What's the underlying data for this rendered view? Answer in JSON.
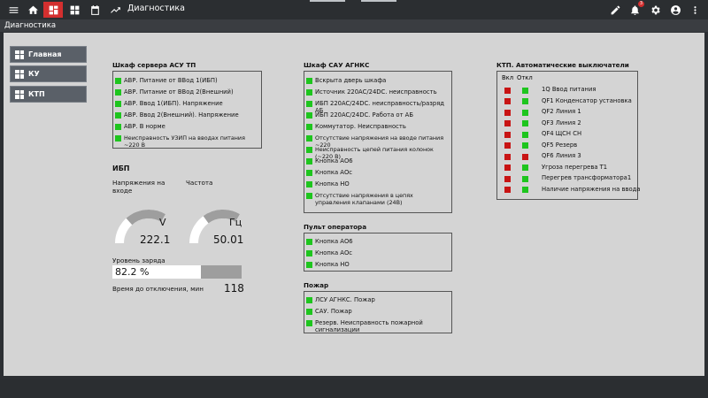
{
  "header": {
    "title": "Диагностика",
    "notification_count": "3"
  },
  "subbar": {
    "title": "Диагностика"
  },
  "nav": [
    {
      "label": "Главная"
    },
    {
      "label": "КУ"
    },
    {
      "label": "КТП"
    }
  ],
  "asu_tp": {
    "title": "Шкаф сервера АСУ ТП",
    "items": [
      "АВР. Питание от ВВод 1(ИБП)",
      "АВР. Питание от ВВод 2(Внешний)",
      "АВР. Ввод 1(ИБП). Напряжение",
      "АВР. Ввод 2(Внешний). Напряжение",
      "АВР. В норме",
      "Неисправность УЗИП на вводах питания ~220 В"
    ]
  },
  "ups": {
    "title": "ИБП",
    "voltage_label": "Напряжения на входе",
    "voltage_unit": "V",
    "voltage_value": "222.1",
    "voltage_level": 0.6,
    "freq_label": "Частота",
    "freq_unit": "Гц",
    "freq_value": "50.01",
    "freq_level": 0.55,
    "charge_label": "Уровень заряда",
    "charge_value": "82.2 %",
    "charge_level": 0.822,
    "time_label": "Время до отключения, мин",
    "time_value": "118"
  },
  "sau": {
    "title": "Шкаф САУ АГНКС",
    "items": [
      "Вскрыта дверь шкафа",
      "Источник 220AC/24DC. неисправность",
      "ИБП 220AC/24DC. неисправность/разряд АБ",
      "ИБП 220AC/24DC. Работа от АБ",
      "Коммутатор. Неисправность",
      "Отсутствие напряжения на вводе питания ~220",
      "Неисправность цепей питания колонок (~220 В)",
      "Кнопка АО6",
      "Кнопка АОс",
      "Кнопка НО",
      "Отсутствие  напряжения в цепях управления клапанами (24В)"
    ]
  },
  "operator": {
    "title": "Пульт оператора",
    "items": [
      "Кнопка АО6",
      "Кнопка АОс",
      "Кнопка НО"
    ]
  },
  "fire": {
    "title": "Пожар",
    "items": [
      "ЛСУ АГНКС. Пожар",
      "САУ. Пожар",
      "Резерв. Неисправность пожарной сигнализации"
    ]
  },
  "ktp": {
    "title": "КТП. Автоматические выключатели",
    "col_on": "Вкл",
    "col_off": "Откл",
    "items": [
      {
        "label": "1Q Ввод питания",
        "on": "red",
        "off": "green"
      },
      {
        "label": "QF1 Конденсатор установка",
        "on": "red",
        "off": "green"
      },
      {
        "label": "QF2 Линия 1",
        "on": "red",
        "off": "green"
      },
      {
        "label": "QF3 Линия 2",
        "on": "red",
        "off": "green"
      },
      {
        "label": "QF4 ЩСН СН",
        "on": "red",
        "off": "green"
      },
      {
        "label": "QF5 Резерв",
        "on": "red",
        "off": "green"
      },
      {
        "label": "QF6 Линия 3",
        "on": "red",
        "off": "red"
      },
      {
        "label": "Угроза перегрева Т1",
        "on": "red",
        "off": "green"
      },
      {
        "label": "Перегрев трансформатора1",
        "on": "red",
        "off": "green"
      },
      {
        "label": "Наличие напряжения на ввода",
        "on": "red",
        "off": "green"
      }
    ]
  },
  "colors": {
    "green": "#1ec51e",
    "red": "#c81414",
    "accent": "#d32f2f",
    "panel": "#d4d4d4"
  }
}
